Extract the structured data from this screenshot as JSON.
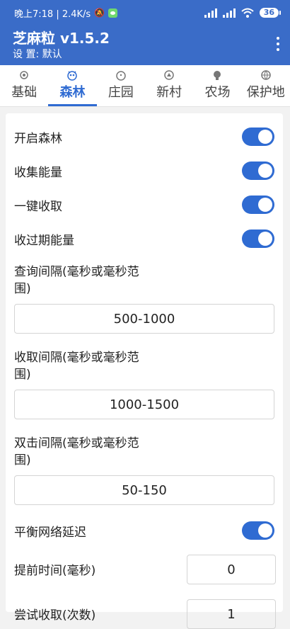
{
  "status_bar": {
    "time_speed": "晚上7:18 | 2.4K/s",
    "battery": "36"
  },
  "app": {
    "title": "芝麻粒 v1.5.2",
    "subtitle": "设 置: 默认"
  },
  "tabs": [
    {
      "label": "基础",
      "icon": "gear-icon",
      "active": false
    },
    {
      "label": "森林",
      "icon": "owl-icon",
      "active": true
    },
    {
      "label": "庄园",
      "icon": "chick-icon",
      "active": false
    },
    {
      "label": "新村",
      "icon": "village-icon",
      "active": false
    },
    {
      "label": "农场",
      "icon": "farm-icon",
      "active": false
    },
    {
      "label": "保护地",
      "icon": "globe-icon",
      "active": false
    }
  ],
  "settings": {
    "open_forest": {
      "label": "开启森林",
      "on": true
    },
    "collect_energy": {
      "label": "收集能量",
      "on": true
    },
    "one_key_collect": {
      "label": "一键收取",
      "on": true
    },
    "collect_expired": {
      "label": "收过期能量",
      "on": true
    },
    "query_interval": {
      "label_line1": "查询间隔(毫秒或毫秒范",
      "label_line2": "围)",
      "value": "500-1000"
    },
    "collect_interval": {
      "label_line1": "收取间隔(毫秒或毫秒范",
      "label_line2": "围)",
      "value": "1000-1500"
    },
    "double_click_interval": {
      "label_line1": "双击间隔(毫秒或毫秒范",
      "label_line2": "围)",
      "value": "50-150"
    },
    "balance_network_delay": {
      "label": "平衡网络延迟",
      "on": true
    },
    "advance_time": {
      "label": "提前时间(毫秒)",
      "value": "0"
    },
    "try_collect_times": {
      "label": "尝试收取(次数)",
      "value": "1"
    }
  },
  "colors": {
    "header": "#3a6cc8",
    "accent": "#2f6bd2"
  }
}
